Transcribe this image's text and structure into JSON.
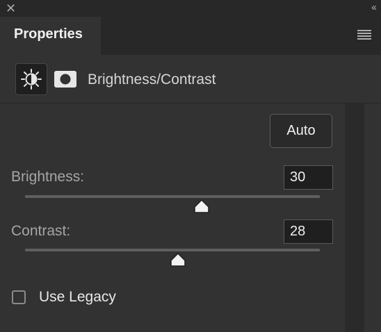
{
  "window": {
    "close_glyph": "✕",
    "collapse_glyph": "‹‹"
  },
  "panel": {
    "tab_label": "Properties",
    "menu_icon": "hamburger-icon"
  },
  "adjustment": {
    "title": "Brightness/Contrast",
    "icons": [
      "brightness-contrast-icon",
      "layer-mask-icon"
    ]
  },
  "controls": {
    "auto_label": "Auto",
    "brightness": {
      "label": "Brightness:",
      "value": "30",
      "range": [
        -150,
        150
      ]
    },
    "contrast": {
      "label": "Contrast:",
      "value": "28",
      "range": [
        -50,
        100
      ]
    },
    "legacy": {
      "label": "Use Legacy",
      "checked": false
    }
  },
  "colors": {
    "panel_bg": "#323232",
    "tab_strip_bg": "#282828",
    "text": "#f0f0f0",
    "muted_text": "#a6a6a6"
  }
}
